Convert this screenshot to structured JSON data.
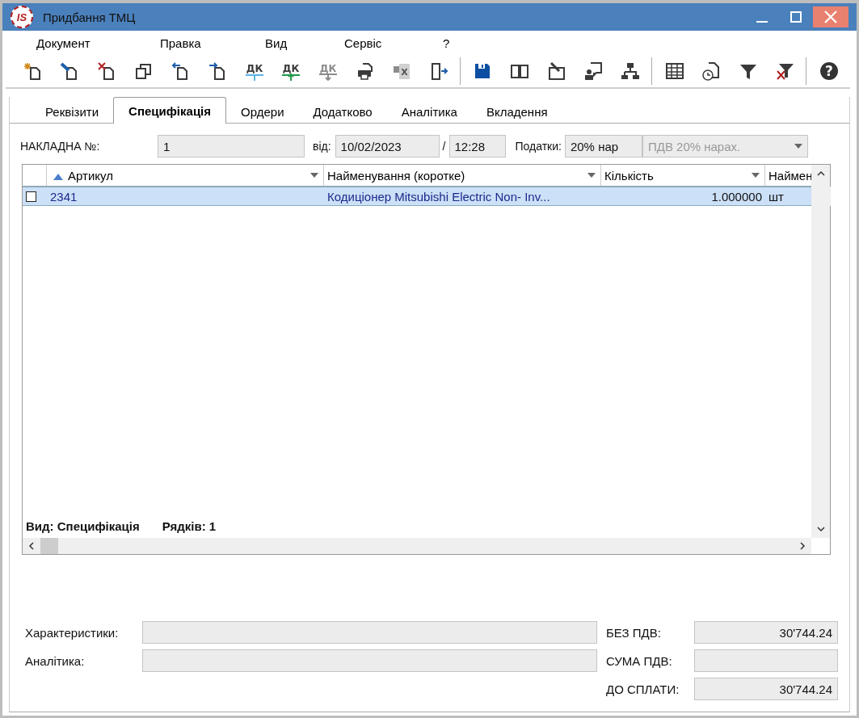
{
  "window": {
    "logo_text": "IS",
    "title": "Придбання ТМЦ"
  },
  "menu": [
    "Документ",
    "Правка",
    "Вид",
    "Сервіс",
    "?"
  ],
  "toolbar_groups": [
    [
      {
        "kind": "new",
        "disabled": false
      },
      {
        "kind": "edit",
        "disabled": false
      },
      {
        "kind": "delete",
        "disabled": false
      },
      {
        "kind": "copy",
        "disabled": false
      },
      {
        "kind": "prev",
        "disabled": false
      },
      {
        "kind": "next",
        "disabled": false
      },
      {
        "kind": "dk-line",
        "glyph": "ДК",
        "disabled": false
      },
      {
        "kind": "dk-up",
        "glyph": "ДК",
        "disabled": false
      },
      {
        "kind": "dk-down",
        "glyph": "ДК",
        "disabled": true
      },
      {
        "kind": "print",
        "disabled": false
      },
      {
        "kind": "spreadsheet",
        "glyph": "X",
        "disabled": true
      },
      {
        "kind": "exit",
        "disabled": false
      }
    ],
    [
      {
        "kind": "save",
        "disabled": false
      },
      {
        "kind": "book",
        "disabled": false
      },
      {
        "kind": "book-edit",
        "disabled": false
      },
      {
        "kind": "user-note",
        "disabled": false
      },
      {
        "kind": "hierarchy",
        "disabled": false
      }
    ],
    [
      {
        "kind": "table",
        "disabled": false
      },
      {
        "kind": "history",
        "disabled": false
      },
      {
        "kind": "filter",
        "disabled": false
      },
      {
        "kind": "filter-clear",
        "disabled": false
      }
    ],
    [
      {
        "kind": "help",
        "glyph": "?",
        "disabled": false
      }
    ]
  ],
  "tabs": [
    {
      "label": "Реквізити",
      "selected": false
    },
    {
      "label": "Специфікація",
      "selected": true
    },
    {
      "label": "Ордери",
      "selected": false
    },
    {
      "label": "Додатково",
      "selected": false
    },
    {
      "label": "Аналітика",
      "selected": false
    },
    {
      "label": "Вкладення",
      "selected": false
    }
  ],
  "header": {
    "invoice_label": "НАКЛАДНА №:",
    "invoice_number": "1",
    "date_label": "від:",
    "date": "10/02/2023",
    "time_separator": "/",
    "time": "12:28",
    "taxes_label": "Податки:",
    "tax_code": "20% нар",
    "tax_name": "ПДВ 20% нарах."
  },
  "table": {
    "columns": [
      {
        "label": "Артикул",
        "sorted": true
      },
      {
        "label": "Найменування (коротке)",
        "sorted": false
      },
      {
        "label": "Кількість",
        "sorted": false
      },
      {
        "label": "Наймен",
        "sorted": false
      }
    ],
    "rows": [
      {
        "checked": false,
        "selected": true,
        "cells": [
          "2341",
          "Кодиціонер Mitsubishi Electric Non- Inv...",
          "1.000000",
          "шт"
        ]
      }
    ],
    "footer": [
      "Вид: Специфікація",
      "Рядків: 1"
    ]
  },
  "details": [
    {
      "label": "Характеристики:"
    },
    {
      "label": "Аналітика:"
    }
  ],
  "totals": [
    {
      "label": "БЕЗ ПДВ:",
      "value": "30'744.24"
    },
    {
      "label": "СУМА ПДВ:"
    },
    {
      "label": "ДО СПЛАТИ:",
      "value": "30'744.24"
    }
  ]
}
